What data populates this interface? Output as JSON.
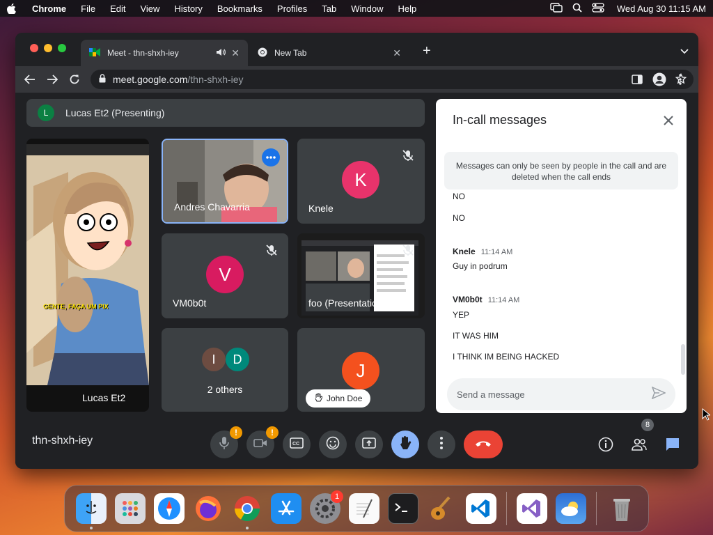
{
  "menubar": {
    "app": "Chrome",
    "items": [
      "File",
      "Edit",
      "View",
      "History",
      "Bookmarks",
      "Profiles",
      "Tab",
      "Window",
      "Help"
    ],
    "clock": "Wed Aug 30  11:15 AM"
  },
  "browser": {
    "tabs": [
      {
        "title": "Meet - thn-shxh-iey",
        "active": true
      },
      {
        "title": "New Tab",
        "active": false
      }
    ],
    "url_host": "meet.google.com",
    "url_path": "/thn-shxh-iey"
  },
  "meet": {
    "presenting": {
      "initial": "L",
      "label": "Lucas Et2 (Presenting)"
    },
    "phone_tile": {
      "name": "Lucas Et2",
      "caption": "GENTE, FAÇA UM PIX"
    },
    "tiles": [
      {
        "name": "Andres Chavarria"
      },
      {
        "name": "Knele",
        "initial": "K",
        "color": "#e8336b"
      },
      {
        "name": "VM0b0t",
        "initial": "V",
        "color": "#d81b60"
      },
      {
        "name": "foo (Presentation)"
      },
      {
        "name": "2 others",
        "initials": [
          "I",
          "D"
        ],
        "colors": [
          "#6d4c41",
          "#00897b"
        ]
      },
      {
        "name": "John Doe",
        "initial": "J",
        "color": "#f4511e"
      }
    ],
    "meeting_code": "thn-shxh-iey",
    "people_count": "8",
    "mic_alert": "!",
    "cam_alert": "!"
  },
  "chat": {
    "title": "In-call messages",
    "notice": "Messages can only be seen by people in the call and are deleted when the call ends",
    "partial_top": "NO",
    "first_line": "NO",
    "groups": [
      {
        "author": "Knele",
        "time": "11:14 AM",
        "lines": [
          "Guy in podrum"
        ]
      },
      {
        "author": "VM0b0t",
        "time": "11:14 AM",
        "lines": [
          "YEP",
          "IT WAS HIM",
          "I THINK IM BEING HACKED"
        ]
      }
    ],
    "compose_placeholder": "Send a message"
  },
  "dock": {
    "settings_badge": "1"
  },
  "colors": {
    "meet_bg": "#202124",
    "tile_bg": "#3c4043",
    "hangup": "#ea4335",
    "raise_hand": "#8ab4f8",
    "chat_active": "#8ab4f8"
  }
}
